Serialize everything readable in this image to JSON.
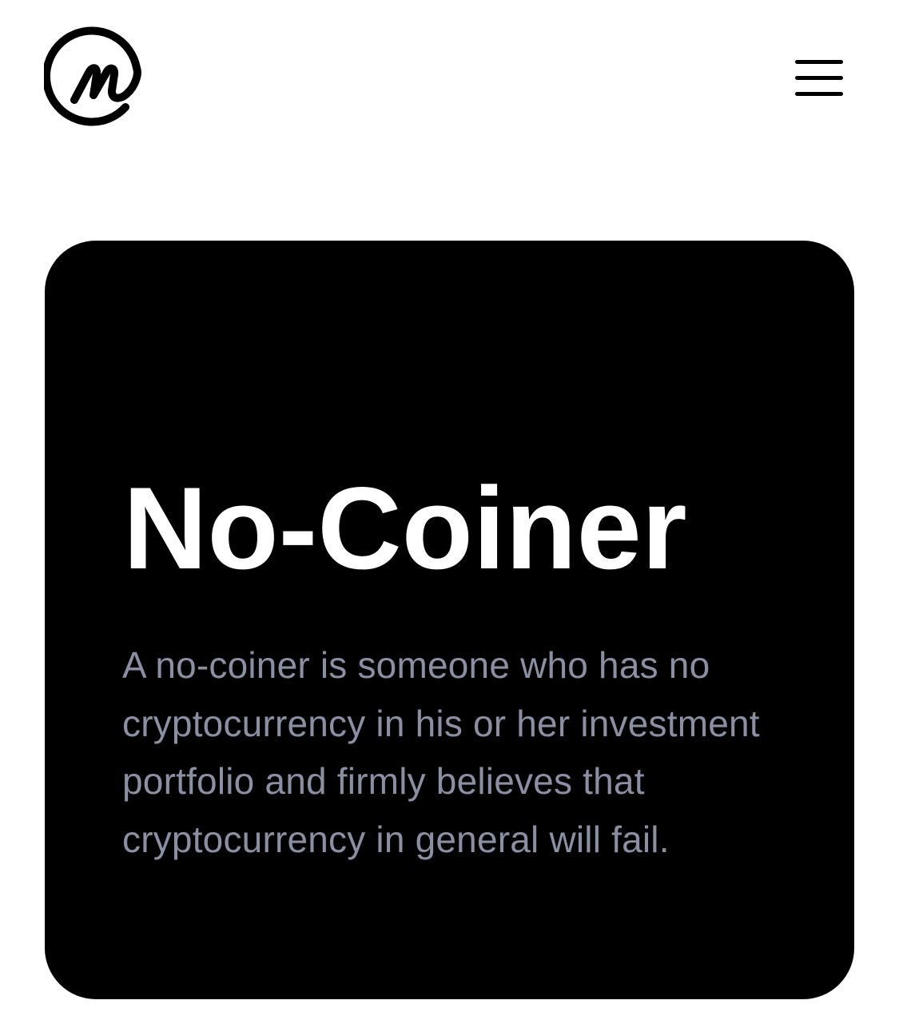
{
  "header": {
    "logo_icon": "coinmarketcap-logo-icon",
    "menu_icon": "hamburger-menu-icon"
  },
  "card": {
    "title": "No-Coiner",
    "description": "A no-coiner is someone who has no cryptocurrency in his or her investment portfolio and firmly believes that cryptocurrency in general will fail."
  },
  "colors": {
    "background": "#ffffff",
    "card_background": "#000000",
    "title": "#ffffff",
    "description": "#8b8fa3",
    "icon": "#000000"
  }
}
